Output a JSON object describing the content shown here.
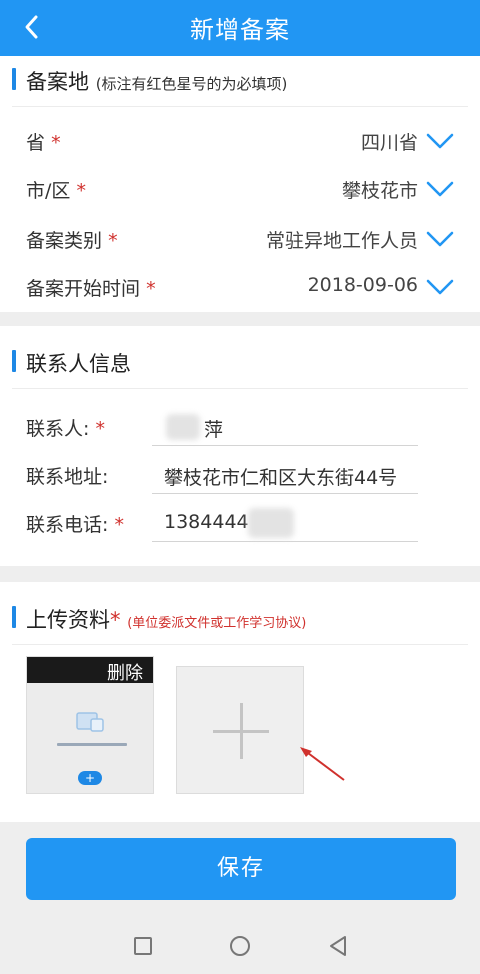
{
  "header": {
    "title": "新增备案",
    "back_icon": "chevron-left-icon"
  },
  "section1": {
    "title": "备案地",
    "hint": "(标注有红色星号的为必填项)",
    "rows": [
      {
        "label": "省",
        "required_mark": "*",
        "value": "四川省"
      },
      {
        "label": "市/区",
        "required_mark": "*",
        "value": "攀枝花市"
      },
      {
        "label": "备案类别",
        "required_mark": "*",
        "value": "常驻异地工作人员"
      },
      {
        "label": "备案开始时间",
        "required_mark": "*",
        "value": "2018-09-06"
      }
    ]
  },
  "section2": {
    "title": "联系人信息",
    "fields": [
      {
        "label": "联系人:",
        "required_mark": "*",
        "value": "萍"
      },
      {
        "label": "联系地址:",
        "required_mark": "",
        "value": "攀枝花市仁和区大东街44号"
      },
      {
        "label": "联系电话:",
        "required_mark": "*",
        "value": "1384444"
      }
    ]
  },
  "section3": {
    "title": "上传资料",
    "required_mark": "*",
    "hint": "(单位委派文件或工作学习协议)",
    "delete_label": "删除"
  },
  "save_label": "保存",
  "colors": {
    "primary": "#2196F3",
    "required": "#d0312d"
  }
}
